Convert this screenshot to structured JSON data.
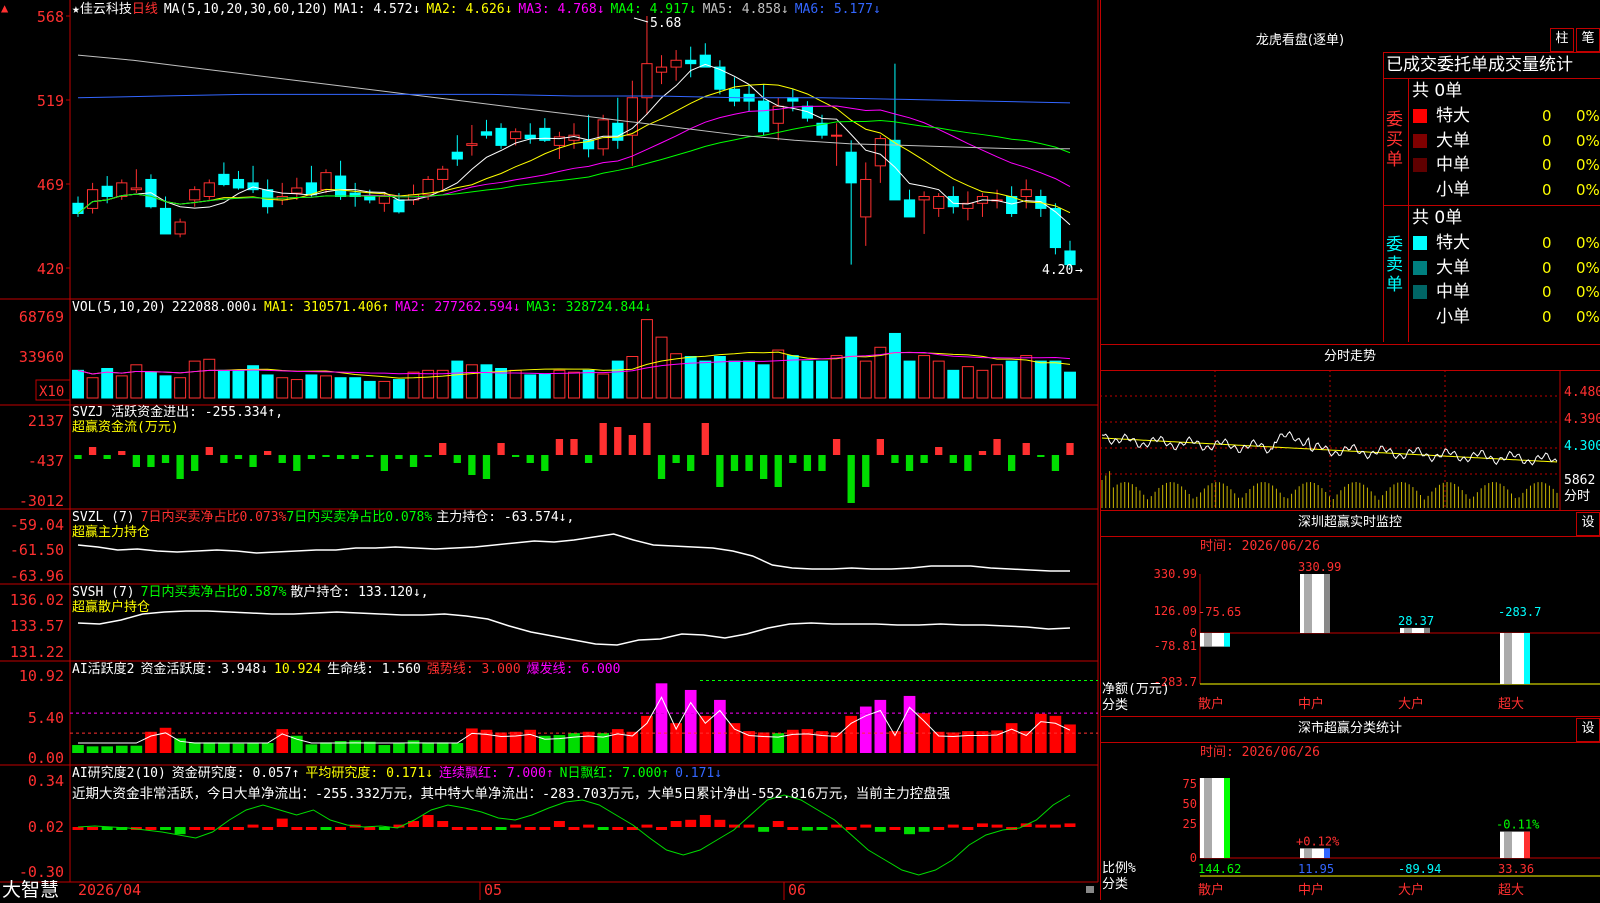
{
  "app_name": "大智慧",
  "stock": {
    "name": "佳云科技",
    "period": "日线"
  },
  "ma_legend": {
    "label": "MA(5,10,20,30,60,120)",
    "items": [
      {
        "text": "MA1: 4.572↓",
        "color": "#ffffff"
      },
      {
        "text": "MA2: 4.626↓",
        "color": "#ffff00"
      },
      {
        "text": "MA3: 4.768↓",
        "color": "#ff00ff"
      },
      {
        "text": "MA4: 4.917↓",
        "color": "#00ff00"
      },
      {
        "text": "MA5: 4.858↓",
        "color": "#c0c0c0"
      },
      {
        "text": "MA6: 5.177↓",
        "color": "#3366ff"
      }
    ]
  },
  "price_axis": {
    "ticks": [
      "568",
      "519",
      "469",
      "420"
    ],
    "high_label": "5.68",
    "low_label": "4.20"
  },
  "vol_legend": {
    "label": "VOL(5,10,20)",
    "items": [
      {
        "text": "222088.000↓",
        "color": "#ffffff"
      },
      {
        "text": "MA1: 310571.406↑",
        "color": "#ffff00"
      },
      {
        "text": "MA2: 277262.594↓",
        "color": "#ff00ff"
      },
      {
        "text": "MA3: 328724.844↓",
        "color": "#00ff00"
      }
    ],
    "ticks": [
      "68769",
      "33960"
    ],
    "unit": "X10"
  },
  "svzj": {
    "label": "SVZJ  活跃资金进出: -255.334↑,",
    "label2": "超赢资金流(万元)",
    "ticks": [
      "2137",
      "-437",
      "-3012"
    ]
  },
  "svzl": {
    "label_a": "SVZL (7)",
    "label_b": "7日内买卖净占比0.073%",
    "label_c": "7日内买卖净占比0.078%",
    "label_d": "主力持仓: -63.574↓,",
    "label2": "超赢主力持仓",
    "ticks": [
      "-59.04",
      "-61.50",
      "-63.96"
    ]
  },
  "svsh": {
    "label_a": "SVSH (7)",
    "label_b": "7日内买卖净占比0.587%",
    "label_c": "散户持仓: 133.120↓,",
    "label2": "超赢散户持仓",
    "ticks": [
      "136.02",
      "133.57",
      "131.22"
    ]
  },
  "ai_active": {
    "label": "AI活跃度2",
    "items": [
      {
        "text": "资金活跃度: 3.948↓",
        "color": "#ffffff"
      },
      {
        "text": "10.924",
        "color": "#ffff00"
      },
      {
        "text": "生命线: 1.560",
        "color": "#ffffff"
      },
      {
        "text": "强势线: 3.000",
        "color": "#ff3030"
      },
      {
        "text": "爆发线: 6.000",
        "color": "#ff00ff"
      }
    ],
    "ticks": [
      "10.92",
      "5.40",
      "0.00"
    ]
  },
  "ai_research": {
    "label": "AI研究度2(10)",
    "items": [
      {
        "text": "资金研究度: 0.057↑",
        "color": "#ffffff"
      },
      {
        "text": "平均研究度: 0.171↓",
        "color": "#ffff00"
      },
      {
        "text": "连续飘红: 7.000↑",
        "color": "#ff00ff"
      },
      {
        "text": "N日飘红: 7.000↑",
        "color": "#00ff00"
      },
      {
        "text": "0.171↓",
        "color": "#3366ff"
      }
    ],
    "note": "近期大资金非常活跃，今日大单净流出：-255.332万元，其中特大单净流出：-283.703万元，大单5日累计净出-552.816万元，当前主力控盘强",
    "ticks": [
      "0.34",
      "0.02",
      "-0.30"
    ]
  },
  "date_axis": {
    "labels": [
      "2026/04",
      "05",
      "06"
    ]
  },
  "longhu": {
    "title": "龙虎看盘(逐单)",
    "btn_zhu": "柱",
    "btn_bi": "笔",
    "header": "已成交委托单成交量统计",
    "buy": {
      "side_label": "委买单",
      "total": "共 0单",
      "rows": [
        {
          "name": "特大",
          "count": "0",
          "pct": "0%",
          "color": "#ff0000"
        },
        {
          "name": "大单",
          "count": "0",
          "pct": "0%",
          "color": "#800000"
        },
        {
          "name": "中单",
          "count": "0",
          "pct": "0%",
          "color": "#600000"
        },
        {
          "name": "小单",
          "count": "0",
          "pct": "0%",
          "color": ""
        }
      ]
    },
    "sell": {
      "side_label": "委卖单",
      "total": "共 0单",
      "rows": [
        {
          "name": "特大",
          "count": "0",
          "pct": "0%",
          "color": "#00ffff"
        },
        {
          "name": "大单",
          "count": "0",
          "pct": "0%",
          "color": "#008080"
        },
        {
          "name": "中单",
          "count": "0",
          "pct": "0%",
          "color": "#006666"
        },
        {
          "name": "小单",
          "count": "0",
          "pct": "0%",
          "color": ""
        }
      ]
    }
  },
  "intraday": {
    "title": "分时走势",
    "prices": [
      "4.480",
      "4.390",
      "4.300"
    ],
    "vol": "5862",
    "vol_label": "分时"
  },
  "monitor": {
    "title": "深圳超赢实时监控",
    "btn": "设",
    "time": "时间: 2026/06/26",
    "ticks": [
      "330.99",
      "126.09",
      "0",
      "-78.81",
      "-283.7"
    ],
    "axis_label": "净额(万元)",
    "cat_label": "分类",
    "categories": [
      "散户",
      "中户",
      "大户",
      "超大"
    ],
    "values": [
      -75.65,
      330.99,
      28.37,
      -283.7
    ],
    "value_labels": [
      "-75.65",
      "330.99",
      "28.37",
      "-283.7"
    ]
  },
  "classify": {
    "title": "深市超赢分类统计",
    "btn": "设",
    "time": "时间: 2026/06/26",
    "ticks": [
      "75",
      "50",
      "25",
      "0"
    ],
    "axis_label": "比例%",
    "cat_label": "分类",
    "categories": [
      "散户",
      "中户",
      "大户",
      "超大"
    ],
    "bottom_values": [
      "144.62",
      "11.95",
      "-89.94",
      "33.36"
    ],
    "bar_pcts": [
      100,
      12,
      0,
      33
    ],
    "change_labels": [
      "",
      "+0.12%",
      "",
      "-0.11%"
    ]
  },
  "chart_data": {
    "type": "candlestick",
    "ohlc_approx": [
      [
        4.58,
        4.62,
        4.5,
        4.52
      ],
      [
        4.55,
        4.7,
        4.52,
        4.66
      ],
      [
        4.68,
        4.74,
        4.58,
        4.62
      ],
      [
        4.62,
        4.72,
        4.6,
        4.7
      ],
      [
        4.66,
        4.78,
        4.64,
        4.67
      ],
      [
        4.72,
        4.75,
        4.55,
        4.56
      ],
      [
        4.55,
        4.62,
        4.4,
        4.4
      ],
      [
        4.4,
        4.49,
        4.38,
        4.47
      ],
      [
        4.6,
        4.68,
        4.56,
        4.66
      ],
      [
        4.62,
        4.72,
        4.6,
        4.7
      ],
      [
        4.75,
        4.82,
        4.68,
        4.69
      ],
      [
        4.72,
        4.77,
        4.66,
        4.67
      ],
      [
        4.7,
        4.8,
        4.64,
        4.66
      ],
      [
        4.66,
        4.72,
        4.52,
        4.56
      ],
      [
        4.6,
        4.7,
        4.57,
        4.62
      ],
      [
        4.64,
        4.73,
        4.6,
        4.67
      ],
      [
        4.7,
        4.8,
        4.62,
        4.63
      ],
      [
        4.66,
        4.78,
        4.64,
        4.76
      ],
      [
        4.74,
        4.83,
        4.6,
        4.62
      ],
      [
        4.64,
        4.7,
        4.56,
        4.62
      ],
      [
        4.62,
        4.66,
        4.58,
        4.6
      ],
      [
        4.58,
        4.64,
        4.53,
        4.62
      ],
      [
        4.6,
        4.64,
        4.52,
        4.53
      ],
      [
        4.6,
        4.69,
        4.57,
        4.63
      ],
      [
        4.63,
        4.74,
        4.6,
        4.72
      ],
      [
        4.72,
        4.8,
        4.66,
        4.78
      ],
      [
        4.88,
        4.98,
        4.8,
        4.84
      ],
      [
        4.92,
        5.04,
        4.86,
        4.93
      ],
      [
        5.0,
        5.07,
        4.96,
        4.98
      ],
      [
        5.02,
        5.05,
        4.9,
        4.92
      ],
      [
        4.96,
        5.02,
        4.92,
        5.0
      ],
      [
        4.98,
        5.05,
        4.93,
        4.96
      ],
      [
        5.02,
        5.08,
        4.94,
        4.95
      ],
      [
        4.92,
        5.0,
        4.84,
        4.97
      ],
      [
        4.95,
        5.05,
        4.9,
        4.98
      ],
      [
        4.95,
        5.1,
        4.85,
        4.9
      ],
      [
        4.9,
        5.1,
        4.86,
        5.07
      ],
      [
        5.05,
        5.2,
        4.9,
        4.95
      ],
      [
        4.98,
        5.3,
        4.8,
        5.2
      ],
      [
        5.2,
        5.68,
        5.1,
        5.4
      ],
      [
        5.35,
        5.45,
        5.28,
        5.38
      ],
      [
        5.38,
        5.48,
        5.3,
        5.42
      ],
      [
        5.42,
        5.5,
        5.32,
        5.4
      ],
      [
        5.45,
        5.52,
        5.38,
        5.38
      ],
      [
        5.38,
        5.42,
        5.22,
        5.25
      ],
      [
        5.25,
        5.32,
        5.15,
        5.18
      ],
      [
        5.22,
        5.28,
        5.12,
        5.18
      ],
      [
        5.18,
        5.28,
        4.98,
        5.0
      ],
      [
        5.05,
        5.2,
        4.95,
        5.15
      ],
      [
        5.2,
        5.25,
        5.12,
        5.18
      ],
      [
        5.15,
        5.18,
        5.06,
        5.08
      ],
      [
        5.05,
        5.1,
        4.96,
        4.98
      ],
      [
        4.98,
        5.05,
        4.8,
        4.98
      ],
      [
        4.88,
        4.95,
        4.22,
        4.7
      ],
      [
        4.5,
        4.82,
        4.33,
        4.72
      ],
      [
        4.8,
        4.98,
        4.7,
        4.96
      ],
      [
        4.95,
        5.4,
        4.8,
        4.6
      ],
      [
        4.6,
        4.66,
        4.5,
        4.5
      ],
      [
        4.6,
        4.65,
        4.4,
        4.62
      ],
      [
        4.55,
        4.64,
        4.5,
        4.62
      ],
      [
        4.62,
        4.68,
        4.52,
        4.56
      ],
      [
        4.55,
        4.65,
        4.48,
        4.58
      ],
      [
        4.58,
        4.64,
        4.5,
        4.62
      ],
      [
        4.6,
        4.66,
        4.55,
        4.6
      ],
      [
        4.62,
        4.68,
        4.5,
        4.52
      ],
      [
        4.62,
        4.72,
        4.55,
        4.66
      ],
      [
        4.62,
        4.66,
        4.5,
        4.55
      ],
      [
        4.55,
        4.58,
        4.28,
        4.32
      ],
      [
        4.3,
        4.36,
        4.2,
        4.22
      ]
    ]
  }
}
